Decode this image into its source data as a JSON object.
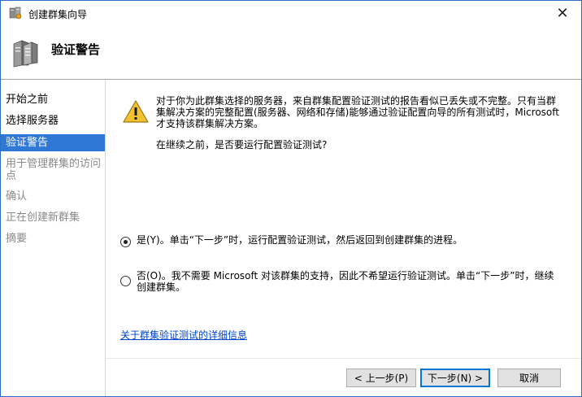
{
  "window": {
    "title": "创建群集向导",
    "close_glyph": "✕"
  },
  "header": {
    "title": "验证警告"
  },
  "sidebar": {
    "items": [
      {
        "label": "开始之前",
        "state": "normal"
      },
      {
        "label": "选择服务器",
        "state": "normal"
      },
      {
        "label": "验证警告",
        "state": "active"
      },
      {
        "label": "用于管理群集的访问点",
        "state": "disabled"
      },
      {
        "label": "确认",
        "state": "disabled"
      },
      {
        "label": "正在创建新群集",
        "state": "disabled"
      },
      {
        "label": "摘要",
        "state": "disabled"
      }
    ]
  },
  "main": {
    "warning_icon": "warning-triangle-icon",
    "warning_text": "对于你为此群集选择的服务器，来自群集配置验证测试的报告看似已丢失或不完整。只有当群集解决方案的完整配置(服务器、网络和存储)能够通过验证配置向导的所有测试时，Microsoft 才支持该群集解决方案。",
    "question": "在继续之前，是否要运行配置验证测试?",
    "options": [
      {
        "label": "是(Y)。单击“下一步”时，运行配置验证测试，然后返回到创建群集的进程。",
        "checked": true
      },
      {
        "label": "否(O)。我不需要 Microsoft 对该群集的支持，因此不希望运行验证测试。单击“下一步”时，继续创建群集。",
        "checked": false
      }
    ],
    "link": "关于群集验证测试的详细信息"
  },
  "footer": {
    "back_label": "< 上一步(P)",
    "next_label": "下一步(N) >",
    "cancel_label": "取消"
  },
  "colors": {
    "accent": "#3078d6",
    "link": "#0044cc",
    "warning": "#f2c230"
  }
}
